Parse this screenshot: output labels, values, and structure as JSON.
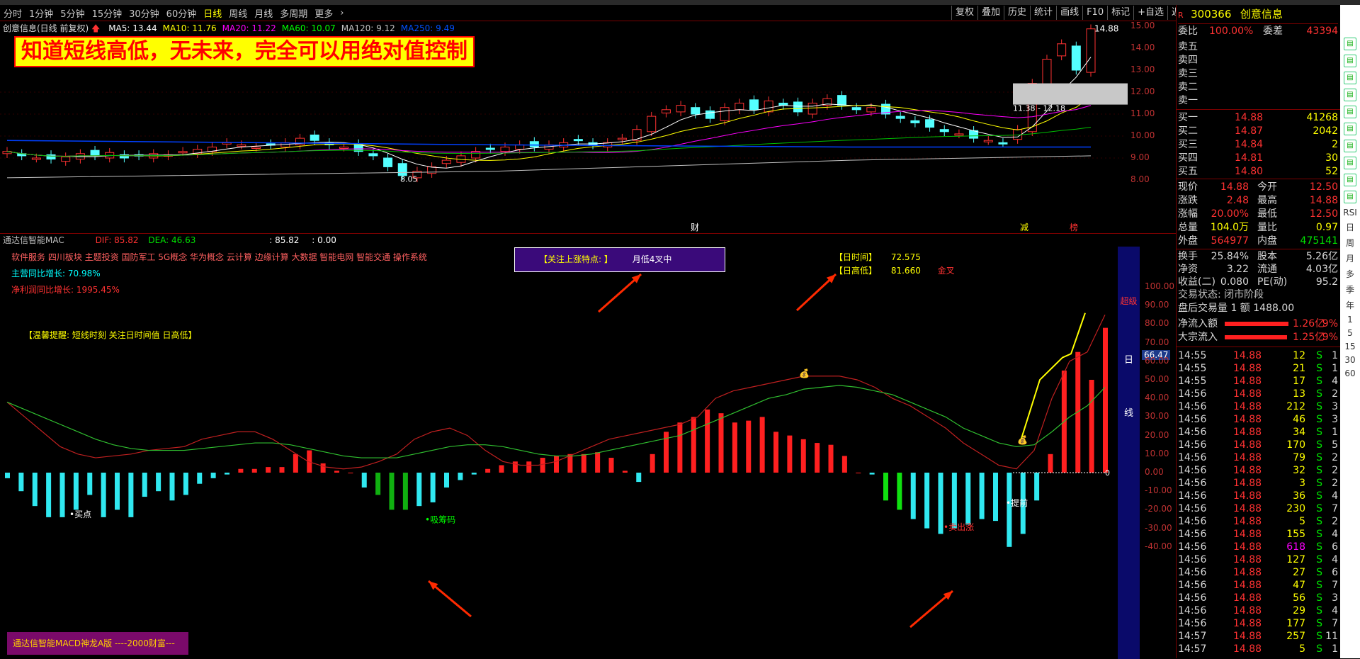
{
  "toolbar": {
    "periods": [
      "分时",
      "1分钟",
      "5分钟",
      "15分钟",
      "30分钟",
      "60分钟",
      "日线",
      "周线",
      "月线",
      "多周期",
      "更多"
    ],
    "active_period": "日线",
    "right_buttons": [
      "复权",
      "叠加",
      "历史",
      "统计",
      "画线",
      "F10",
      "标记",
      "+自选",
      "返回"
    ]
  },
  "main_chart": {
    "title": "创意信息(日线 前复权)",
    "ma": [
      {
        "label": "MA5: 13.44",
        "color": "#ffffff"
      },
      {
        "label": "MA10: 11.76",
        "color": "#ffff00"
      },
      {
        "label": "MA20: 11.22",
        "color": "#ff00ff"
      },
      {
        "label": "MA60: 10.07",
        "color": "#00ff00"
      },
      {
        "label": "MA120: 9.12",
        "color": "#c0c0c0"
      },
      {
        "label": "MA250: 9.49",
        "color": "#0050ff"
      }
    ],
    "banner": "知道短线高低，无未来，完全可以用绝对值控制",
    "high_label": "14.88",
    "low_label": "8.05",
    "range_label": "11.38 - 12.18",
    "y_ticks": [
      "15.00",
      "14.00",
      "13.00",
      "12.00",
      "11.00",
      "10.00",
      "9.00",
      "8.00"
    ],
    "markers": [
      "财",
      "减",
      "榜"
    ]
  },
  "indicator": {
    "name": "通达信智能MAC",
    "dif": "DIF: 85.82",
    "dea": "DEA: 46.63",
    "v1": ": 85.82",
    "v2": ": 0.00",
    "concepts": "软件服务 四川板块 主题投资 国防军工 5G概念 华为概念 云计算 边缘计算 大数据 智能电网 智能交通 操作系统",
    "revenue": "主营同比增长: 70.98%",
    "profit": "净利润同比增长: 1995.45%",
    "tip": "【温馨提醒: 短线时刻 关注日时间值 日高低】",
    "focus": "【关注上涨特点: 】",
    "focus_value": "月低4叉中",
    "time_label": "【日时间】",
    "time_value": "72.575",
    "highlow_label": "【日高低】",
    "highlow_value": "81.660",
    "golden": "金叉",
    "labels": {
      "buy": "买点",
      "absorb": "吸筹码",
      "sell": "卖出涨",
      "early": "提前"
    },
    "side_text": [
      "超级",
      "日",
      "线"
    ],
    "current_value": "66.47",
    "zero_label": "0",
    "y_ticks": [
      "100.00",
      "90.00",
      "80.00",
      "70.00",
      "60.00",
      "50.00",
      "40.00",
      "30.00",
      "20.00",
      "10.00",
      "0.00",
      "-10.00",
      "-20.00",
      "-30.00",
      "-40.00"
    ],
    "bottom_label": "通达信智能MACD神龙A版 ----2000财富---"
  },
  "quote": {
    "code": "300366",
    "name": "创意信息",
    "webi_label": "委比",
    "webi": "100.00%",
    "wecha_label": "委差",
    "wecha": "43394",
    "sell": [
      {
        "label": "卖五",
        "price": "",
        "vol": ""
      },
      {
        "label": "卖四",
        "price": "",
        "vol": ""
      },
      {
        "label": "卖三",
        "price": "",
        "vol": ""
      },
      {
        "label": "卖二",
        "price": "",
        "vol": ""
      },
      {
        "label": "卖一",
        "price": "",
        "vol": ""
      }
    ],
    "buy": [
      {
        "label": "买一",
        "price": "14.88",
        "vol": "41268"
      },
      {
        "label": "买二",
        "price": "14.87",
        "vol": "2042"
      },
      {
        "label": "买三",
        "price": "14.84",
        "vol": "2"
      },
      {
        "label": "买四",
        "price": "14.81",
        "vol": "30"
      },
      {
        "label": "买五",
        "price": "14.80",
        "vol": "52"
      }
    ],
    "stats": [
      {
        "l1": "现价",
        "v1": "14.88",
        "l2": "今开",
        "v2": "12.50"
      },
      {
        "l1": "涨跌",
        "v1": "2.48",
        "l2": "最高",
        "v2": "14.88"
      },
      {
        "l1": "涨幅",
        "v1": "20.00%",
        "l2": "最低",
        "v2": "12.50"
      },
      {
        "l1": "总量",
        "v1": "104.0万",
        "l2": "量比",
        "v2": "0.97"
      },
      {
        "l1": "外盘",
        "v1": "564977",
        "l2": "内盘",
        "v2": "475141"
      }
    ],
    "stats2": [
      {
        "l1": "换手",
        "v1": "25.84%",
        "l2": "股本",
        "v2": "5.26亿"
      },
      {
        "l1": "净资",
        "v1": "3.22",
        "l2": "流通",
        "v2": "4.03亿"
      },
      {
        "l1": "收益(二)",
        "v1": "0.080",
        "l2": "PE(动)",
        "v2": "95.2"
      }
    ],
    "trade_status": "交易状态: 闭市阶段",
    "after_volume": "盘后交易量 1 额 1488.00",
    "net_inflow_label": "净流入额",
    "net_inflow": "1.26亿",
    "net_inflow_pct": "9%",
    "big_inflow_label": "大宗流入",
    "big_inflow": "1.25亿",
    "big_inflow_pct": "9%",
    "ticks": [
      {
        "t": "14:55",
        "p": "14.88",
        "v": "12",
        "s": "S",
        "n": "1"
      },
      {
        "t": "14:55",
        "p": "14.88",
        "v": "21",
        "s": "S",
        "n": "1"
      },
      {
        "t": "14:55",
        "p": "14.88",
        "v": "17",
        "s": "S",
        "n": "4"
      },
      {
        "t": "14:56",
        "p": "14.88",
        "v": "13",
        "s": "S",
        "n": "2"
      },
      {
        "t": "14:56",
        "p": "14.88",
        "v": "212",
        "s": "S",
        "n": "3"
      },
      {
        "t": "14:56",
        "p": "14.88",
        "v": "46",
        "s": "S",
        "n": "3"
      },
      {
        "t": "14:56",
        "p": "14.88",
        "v": "34",
        "s": "S",
        "n": "1"
      },
      {
        "t": "14:56",
        "p": "14.88",
        "v": "170",
        "s": "S",
        "n": "5"
      },
      {
        "t": "14:56",
        "p": "14.88",
        "v": "79",
        "s": "S",
        "n": "2"
      },
      {
        "t": "14:56",
        "p": "14.88",
        "v": "32",
        "s": "S",
        "n": "2"
      },
      {
        "t": "14:56",
        "p": "14.88",
        "v": "3",
        "s": "S",
        "n": "2"
      },
      {
        "t": "14:56",
        "p": "14.88",
        "v": "36",
        "s": "S",
        "n": "4"
      },
      {
        "t": "14:56",
        "p": "14.88",
        "v": "230",
        "s": "S",
        "n": "7"
      },
      {
        "t": "14:56",
        "p": "14.88",
        "v": "5",
        "s": "S",
        "n": "2"
      },
      {
        "t": "14:56",
        "p": "14.88",
        "v": "155",
        "s": "S",
        "n": "4"
      },
      {
        "t": "14:56",
        "p": "14.88",
        "v": "618",
        "s": "S",
        "n": "6"
      },
      {
        "t": "14:56",
        "p": "14.88",
        "v": "127",
        "s": "S",
        "n": "4"
      },
      {
        "t": "14:56",
        "p": "14.88",
        "v": "27",
        "s": "S",
        "n": "6"
      },
      {
        "t": "14:56",
        "p": "14.88",
        "v": "47",
        "s": "S",
        "n": "7"
      },
      {
        "t": "14:56",
        "p": "14.88",
        "v": "56",
        "s": "S",
        "n": "3"
      },
      {
        "t": "14:56",
        "p": "14.88",
        "v": "29",
        "s": "S",
        "n": "4"
      },
      {
        "t": "14:56",
        "p": "14.88",
        "v": "177",
        "s": "S",
        "n": "7"
      },
      {
        "t": "14:57",
        "p": "14.88",
        "v": "257",
        "s": "S",
        "n": "11"
      },
      {
        "t": "14:57",
        "p": "14.88",
        "v": "5",
        "s": "S",
        "n": "1"
      }
    ]
  },
  "side_tools": [
    "RSI",
    "日",
    "周",
    "月",
    "多",
    "季",
    "年",
    "1",
    "5",
    "15",
    "30",
    "60"
  ]
}
